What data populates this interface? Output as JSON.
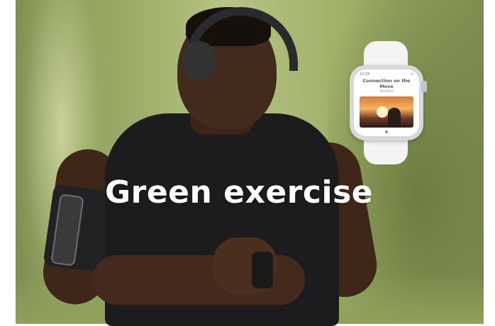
{
  "headline": "Green exercise",
  "watch_app": {
    "status_time": "10:09",
    "title": "Connection on the Move",
    "subtitle": "Routine"
  },
  "colors": {
    "headline_text": "#ffffff",
    "background_foliage": "#98a763",
    "shirt": "#1c1c1e",
    "watch_case": "#d8d8da",
    "watch_strap": "#f4f4f4"
  },
  "icons": [
    "headphones-icon",
    "armband-phone-icon",
    "smartwatch-icon"
  ]
}
